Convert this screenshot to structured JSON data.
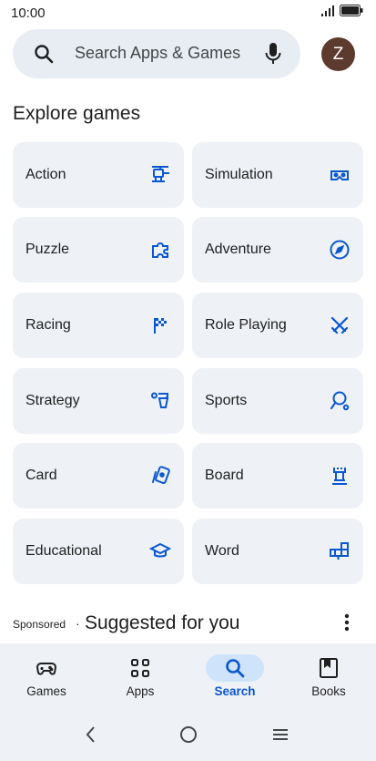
{
  "status": {
    "time": "10:00"
  },
  "search": {
    "placeholder": "Search Apps & Games",
    "avatar_letter": "Z"
  },
  "section_title": "Explore games",
  "categories": [
    {
      "label": "Action",
      "icon": "helicopter-icon"
    },
    {
      "label": "Simulation",
      "icon": "vr-headset-icon"
    },
    {
      "label": "Puzzle",
      "icon": "puzzle-piece-icon"
    },
    {
      "label": "Adventure",
      "icon": "compass-icon"
    },
    {
      "label": "Racing",
      "icon": "checkered-flag-icon"
    },
    {
      "label": "Role Playing",
      "icon": "crossed-swords-icon"
    },
    {
      "label": "Strategy",
      "icon": "strategy-icon"
    },
    {
      "label": "Sports",
      "icon": "ping-pong-icon"
    },
    {
      "label": "Card",
      "icon": "playing-cards-icon"
    },
    {
      "label": "Board",
      "icon": "chess-rook-icon"
    },
    {
      "label": "Educational",
      "icon": "graduation-cap-icon"
    },
    {
      "label": "Word",
      "icon": "word-tiles-icon"
    }
  ],
  "suggested": {
    "sponsored": "Sponsored",
    "separator": "·",
    "title": "Suggested for you"
  },
  "bottom_nav": [
    {
      "label": "Games",
      "icon": "gamepad-icon",
      "active": false
    },
    {
      "label": "Apps",
      "icon": "apps-grid-icon",
      "active": false
    },
    {
      "label": "Search",
      "icon": "search-icon",
      "active": true
    },
    {
      "label": "Books",
      "icon": "bookmark-book-icon",
      "active": false
    }
  ],
  "colors": {
    "accent": "#0b57d0",
    "tile_bg": "#eef1f6",
    "search_bg": "#e8edf4",
    "avatar_bg": "#5d3a2e",
    "active_pill": "#cfe4fb"
  }
}
